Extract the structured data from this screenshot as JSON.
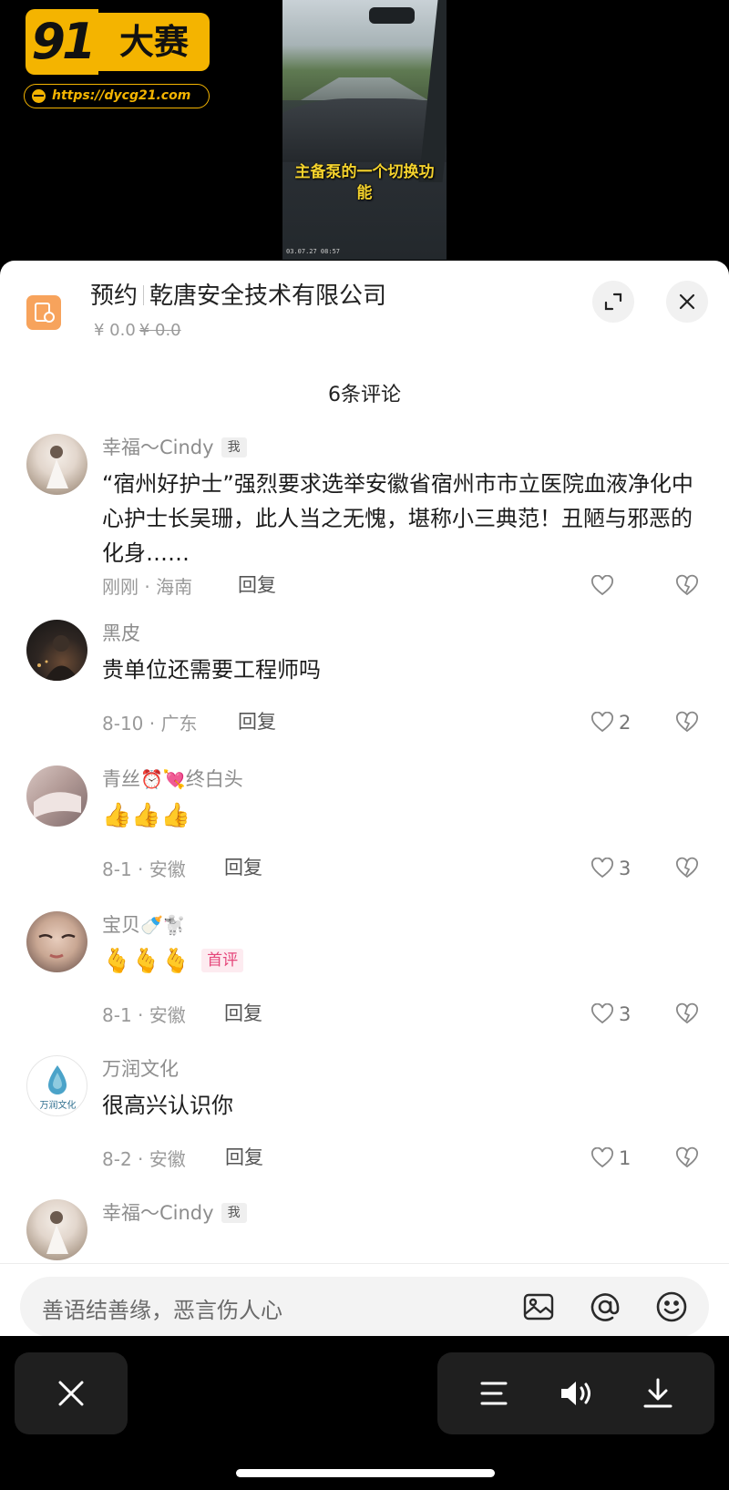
{
  "video": {
    "caption": "主备泵的一个切换功能",
    "timestamp": "03.07.27 08:57"
  },
  "watermark": {
    "logo_number": "91",
    "logo_text": "大赛",
    "url": "https://dycg21.com",
    "brand_color": "#f4b400"
  },
  "appointment": {
    "label": "预约",
    "company": "乾唐安全技术有限公司",
    "price": "¥ 0.0",
    "original_price": "¥ 0.0",
    "icon": "appointment-icon",
    "icon_color": "#f7a35c"
  },
  "header_buttons": {
    "expand_icon": "expand-icon",
    "close_icon": "close-icon"
  },
  "comments_header": {
    "title": "6条评论"
  },
  "comments": [
    {
      "user": "幸福～Cindy",
      "tag": "我",
      "text": "“宿州好护士”强烈要求选举安徽省宿州市市立医院血液净化中心护士长吴珊，此人当之无愧，堪称小三典范！丑陋与邪恶的化身……",
      "time": "刚刚",
      "location": "海南",
      "meta": "刚刚 · 海南",
      "reply": "回复",
      "likes": ""
    },
    {
      "user": "黑皮",
      "text": "贵单位还需要工程师吗",
      "meta": "8-10 · 广东",
      "reply": "回复",
      "likes": "2"
    },
    {
      "user": "青丝⏰💘终白头",
      "user_prefix": "青丝",
      "user_emojis": "⏰💘",
      "user_suffix": "终白头",
      "text": "👍👍👍",
      "meta": "8-1 · 安徽",
      "reply": "回复",
      "likes": "3"
    },
    {
      "user": "宝贝🍼🐩",
      "user_prefix": "宝贝",
      "user_emojis": "🍼🐩",
      "text": "🫰🫰🫰",
      "first_tag": "首评",
      "meta": "8-1 · 安徽",
      "reply": "回复",
      "likes": "3"
    },
    {
      "user": "万润文化",
      "avatar_text": "万润文化",
      "text": "很高兴认识你",
      "meta": "8-2 · 安徽",
      "reply": "回复",
      "likes": "1"
    },
    {
      "user": "幸福～Cindy",
      "tag": "我"
    }
  ],
  "input": {
    "placeholder": "善语结善缘，恶言伤人心",
    "image_icon": "image-icon",
    "at_icon": "at-icon",
    "emoji_icon": "emoji-icon"
  },
  "bottom_controls": {
    "close_icon": "close-icon",
    "menu_icon": "menu-icon",
    "volume_icon": "volume-icon",
    "download_icon": "download-icon"
  }
}
